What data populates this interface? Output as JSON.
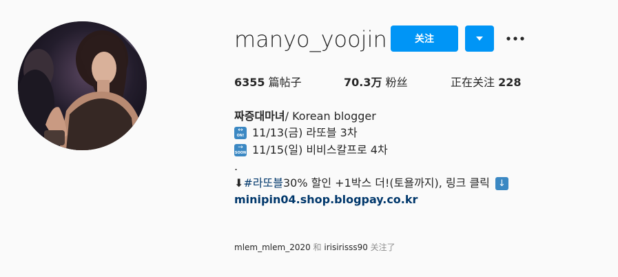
{
  "profile": {
    "username": "manyo_yoojin",
    "follow_label": "关注",
    "dropdown_icon": "caret-down-icon",
    "more_icon": "more-options-icon",
    "avatar_alt": "profile-photo"
  },
  "stats": {
    "posts_count": "6355",
    "posts_label": " 篇帖子",
    "followers_count": "70.3万",
    "followers_label": " 粉丝",
    "following_label": "正在关注 ",
    "following_count": "228"
  },
  "bio": {
    "name": "짜증대마녀",
    "name_suffix": " / Korean blogger",
    "line1_emoji_word": "ON!",
    "line1_text": "11/13(금) 라또블 3차",
    "line2_emoji_word": "SOON",
    "line2_text": "11/15(일) 비비스칼프로 4차",
    "dot": ".",
    "line4_arrow": "⬇",
    "line4_hashtag": "#라또블",
    "line4_text": " 30% 할인 +1박스 더!(토욜까지), 링크 클릭",
    "line4_box_arrow": "↓",
    "link": "minipin04.shop.blogpay.co.kr"
  },
  "followed_by": {
    "user1": "mlem_mlem_2020",
    "and": " 和 ",
    "user2": "irisirisss90",
    "suffix": " 关注了"
  },
  "colors": {
    "accent": "#0095f6",
    "link": "#00376b",
    "emoji_blue": "#3b88c3",
    "background": "#fafafa"
  }
}
